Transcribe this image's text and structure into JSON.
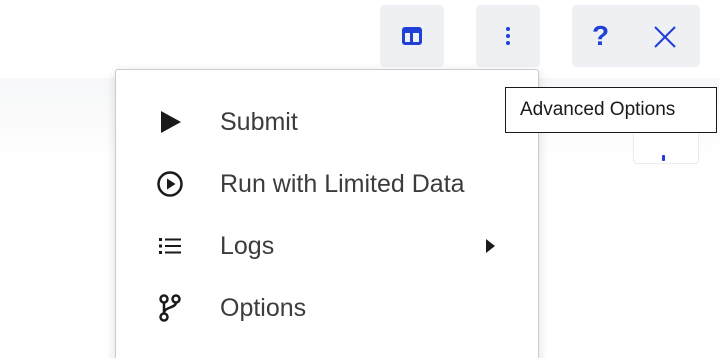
{
  "colors": {
    "accent": "#1f3fd6",
    "button_bg": "#eef0f3",
    "menu_text": "#3c3c3c",
    "tooltip_border": "#1a1a1a"
  },
  "toolbar": {
    "buttons": [
      {
        "icon": "panels-icon"
      },
      {
        "icon": "more-vertical-icon"
      },
      {
        "icon": "help-icon",
        "glyph": "?"
      },
      {
        "icon": "close-icon"
      }
    ]
  },
  "tooltip": {
    "text": "Advanced Options"
  },
  "menu": {
    "items": [
      {
        "icon": "play-icon",
        "label": "Submit"
      },
      {
        "icon": "play-circle-icon",
        "label": "Run with Limited Data"
      },
      {
        "icon": "list-icon",
        "label": "Logs",
        "has_submenu": true
      },
      {
        "icon": "branch-icon",
        "label": "Options"
      }
    ]
  }
}
